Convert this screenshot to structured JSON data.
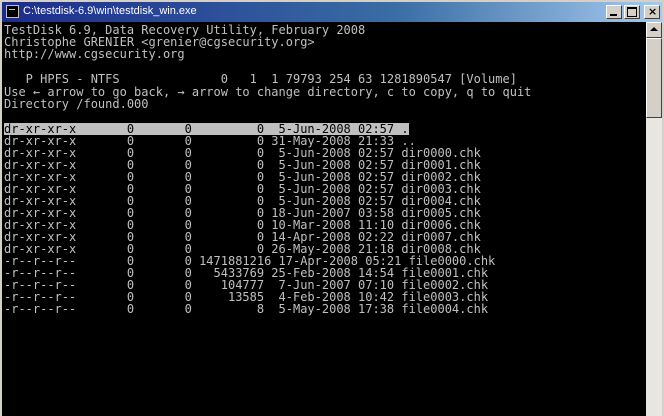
{
  "window": {
    "title": "C:\\testdisk-6.9\\win\\testdisk_win.exe"
  },
  "console": {
    "header": [
      "TestDisk 6.9, Data Recovery Utility, February 2008",
      "Christophe GRENIER <grenier@cgsecurity.org>",
      "http://www.cgsecurity.org"
    ],
    "partition": "   P HPFS - NTFS              0   1  1 79793 254 63 1281890547 [Volume]",
    "help": "Use ← arrow to go back, → arrow to change directory, c to copy, q to quit",
    "directory": "Directory /found.000",
    "selected_index": 0,
    "entries": [
      "dr-xr-xr-x       0       0         0  5-Jun-2008 02:57 .",
      "dr-xr-xr-x       0       0         0 31-May-2008 21:33 ..",
      "dr-xr-xr-x       0       0         0  5-Jun-2008 02:57 dir0000.chk",
      "dr-xr-xr-x       0       0         0  5-Jun-2008 02:57 dir0001.chk",
      "dr-xr-xr-x       0       0         0  5-Jun-2008 02:57 dir0002.chk",
      "dr-xr-xr-x       0       0         0  5-Jun-2008 02:57 dir0003.chk",
      "dr-xr-xr-x       0       0         0  5-Jun-2008 02:57 dir0004.chk",
      "dr-xr-xr-x       0       0         0 18-Jun-2007 03:58 dir0005.chk",
      "dr-xr-xr-x       0       0         0 10-Mar-2008 11:10 dir0006.chk",
      "dr-xr-xr-x       0       0         0 14-Apr-2008 02:22 dir0007.chk",
      "dr-xr-xr-x       0       0         0 26-May-2008 21:18 dir0008.chk",
      "-r--r--r--       0       0 1471881216 17-Apr-2008 05:21 file0000.chk",
      "-r--r--r--       0       0   5433769 25-Feb-2008 14:54 file0001.chk",
      "-r--r--r--       0       0    104777  7-Jun-2007 07:10 file0002.chk",
      "-r--r--r--       0       0     13585  4-Feb-2008 10:42 file0003.chk",
      "-r--r--r--       0       0         8  5-May-2008 17:38 file0004.chk"
    ]
  }
}
